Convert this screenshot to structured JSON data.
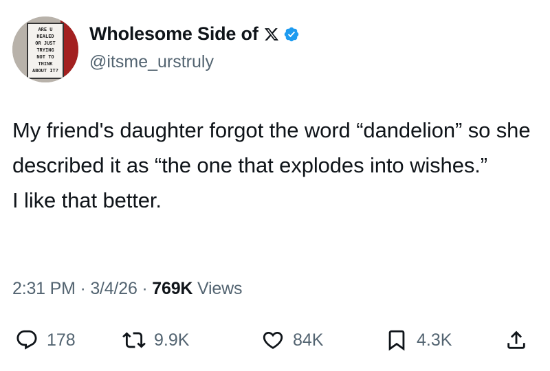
{
  "author": {
    "display_name": "Wholesome Side of",
    "handle": "@itsme_urstruly",
    "avatar_sign_text": [
      "ARE U",
      "HEALED",
      "OR JUST",
      "TRYING",
      "NOT TO",
      "THINK",
      "ABOUT IT?"
    ]
  },
  "tweet": {
    "lines": [
      "My friend's daughter forgot the word “dandelion” so she described it as “the one that explodes into wishes.”",
      "I like that better."
    ]
  },
  "meta": {
    "time": "2:31 PM",
    "date": "3/4/26",
    "separator": "·",
    "views_count": "769K",
    "views_label": "Views"
  },
  "actions": {
    "replies": "178",
    "reposts": "9.9K",
    "likes": "84K",
    "bookmarks": "4.3K"
  },
  "colors": {
    "text": "#0f1419",
    "secondary": "#536471",
    "verified": "#1d9bf0"
  },
  "icons": [
    "x-logo-icon",
    "verified-badge-icon",
    "reply-icon",
    "repost-icon",
    "like-icon",
    "bookmark-icon",
    "share-icon"
  ]
}
